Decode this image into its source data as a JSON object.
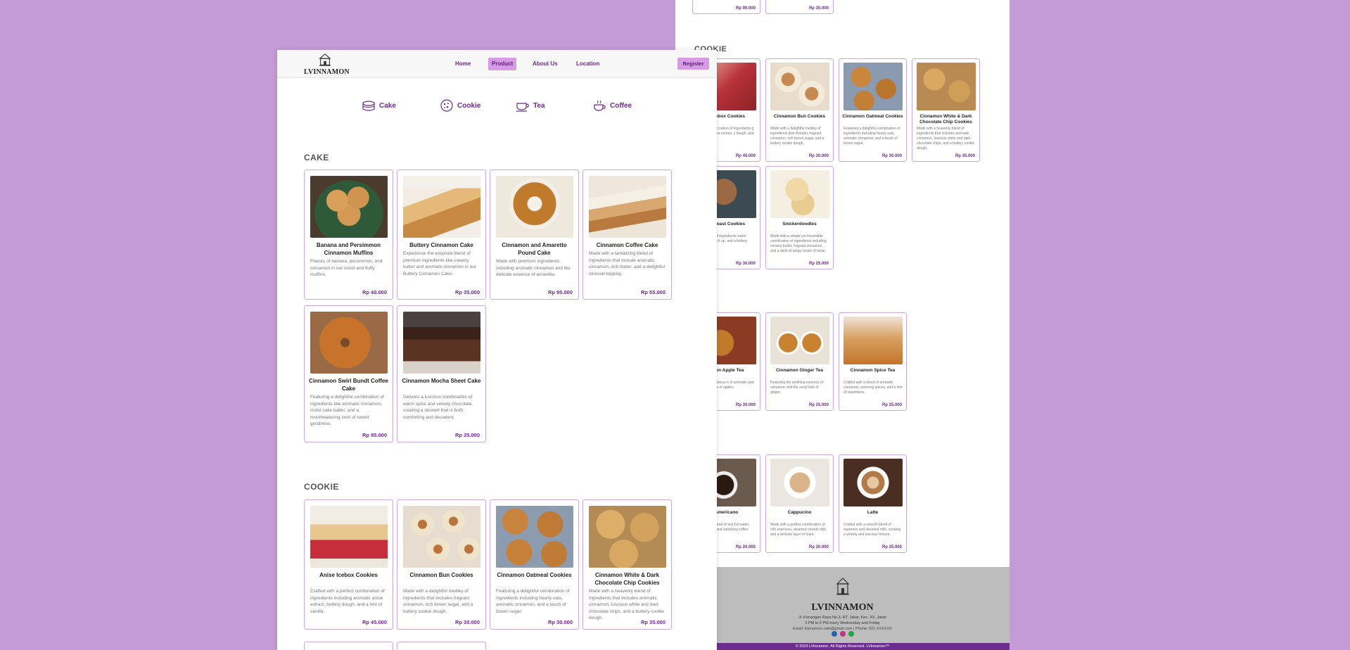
{
  "brand": {
    "name": "LVINNAMON"
  },
  "nav": {
    "links": [
      "Home",
      "Product",
      "About Us",
      "Location"
    ],
    "active": "Product",
    "register_label": "Register"
  },
  "categories": [
    "Cake",
    "Cookie",
    "Tea",
    "Coffee"
  ],
  "sections": {
    "cake": "CAKE",
    "cookie": "COOKIE"
  },
  "cakes": [
    {
      "name": "Banana and Persimmon Cinnamon Muffins",
      "desc": "Flavors of banana, persimmon, and cinnamon in our moist and fluffy muffins.",
      "price": "Rp 40.000"
    },
    {
      "name": "Buttery Cinnamon Cake",
      "desc": "Experience the exquisite blend of premium ingredients like creamy butter and aromatic cinnamon in our Buttery Cinnamon Cake.",
      "price": "Rp 35.000"
    },
    {
      "name": "Cinnamon and Amaretto Pound Cake",
      "desc": "Made with premium ingredients including aromatic cinnamon and the delicate essence of amaretto.",
      "price": "Rp 95.000"
    },
    {
      "name": "Cinnamon Coffee Cake",
      "desc": "Made with a tantalizing blend of ingredients that include aromatic cinnamon, rich butter, and a delightful streusel topping.",
      "price": "Rp 55.000"
    },
    {
      "name": "Cinnamon Swirl Bundt Coffee Cake",
      "desc": "Featuring a delightful combination of ingredients like aromatic cinnamon, moist cake batter, and a mouthwatering swirl of sweet goodness.",
      "price": "Rp 95.000"
    },
    {
      "name": "Cinnamon Mocha Sheet Cake",
      "desc": "Delivers a luscious combination of warm spice and velvety chocolate, creating a dessert that is both comforting and decadent.",
      "price": "Rp 35.000"
    }
  ],
  "cookies": [
    {
      "name": "Anise Icebox Cookies",
      "desc": "Crafted with a perfect combination of ingredients including aromatic anise extract, buttery dough, and a hint of vanilla.",
      "price": "Rp 45.000"
    },
    {
      "name": "Cinnamon Bun Cookies",
      "desc": "Made with a delightful medley of ingredients that includes fragrant cinnamon, rich brown sugar, and a buttery cookie dough.",
      "price": "Rp 30.000"
    },
    {
      "name": "Cinnamon Oatmeal Cookies",
      "desc": "Featuring a delightful combination of ingredients including hearty oats, aromatic cinnamon, and a touch of brown sugar.",
      "price": "Rp 30.000"
    },
    {
      "name": "Cinnamon White & Dark Chocolate Chip Cookies",
      "desc": "Made with a heavenly blend of ingredients that includes aromatic cinnamon, luscious white and dark chocolate chips, and a buttery cookie dough.",
      "price": "Rp 35.000"
    }
  ],
  "back": {
    "top_prices": [
      "Rp 90.000",
      "Rp 35.000"
    ],
    "cookie_title": "COOKIE",
    "cookies": [
      {
        "name": "e Icebox Cookies",
        "desc": "with a perfect nation of ingredients g aromatic anise extract, y dough, and a hint of",
        "price": "Rp 45.000"
      },
      {
        "name": "Cinnamon Bun Cookies",
        "desc": "Made with a delightful medley of ingredients that includes fragrant cinnamon, rich brown sugar, and a buttery cookie dough.",
        "price": "Rp 30.000"
      },
      {
        "name": "Cinnamon Oatmeal Cookies",
        "desc": "Featuring a delightful combination of ingredients including hearty oats, aromatic cinnamon, and a touch of brown sugar.",
        "price": "Rp 30.000"
      },
      {
        "name": "Cinnamon White & Dark Chocolate Chip Cookies",
        "desc": "Made with a heavenly blend of ingredients that includes aromatic cinnamon, luscious white and dark chocolate chips, and a buttery cookie dough.",
        "price": "Rp 35.000"
      },
      {
        "name": "ch Toast Cookies",
        "desc": "the medley of ingredients warm cinnamon, rich up, and a buttery",
        "price": "Rp 30.000"
      },
      {
        "name": "Snickerdoodles",
        "desc": "Made with a simple yet irresistible combination of ingredients including creamy butter, fragrant cinnamon, and a dash of tangy cream of tartar.",
        "price": "Rp 25.000"
      }
    ],
    "teas": [
      {
        "name": "amon Apple Tea",
        "desc": "with a harmonious n of aromatic and the natural ss of apples.",
        "price": "Rp 30.000"
      },
      {
        "name": "Cinnamon Ginger Tea",
        "desc": "Featuring the soothing essence of cinnamon and the zesty kick of ginger.",
        "price": "Rp 25.000"
      },
      {
        "name": "Cinnamon Spice Tea",
        "desc": "Crafted with a blend of aromatic cinnamon, warming spices, and a hint of sweetness.",
        "price": "Rp 25.000"
      }
    ],
    "coffee_title": "E",
    "coffees": [
      {
        "name": "Americano",
        "desc": "with a rich blend of and hot water, creating ust and satisfying coffee",
        "price": "Rp 20.000"
      },
      {
        "name": "Cappucino",
        "desc": "Made with a perfect combination of rich espresso, steamed velvety milk, and a delicate layer of foam.",
        "price": "Rp 30.000"
      },
      {
        "name": "Latte",
        "desc": "Crafted with a smooth blend of espresso and steamed milk, creating a velvety and luscious texture.",
        "price": "Rp 25.000"
      }
    ],
    "footer": {
      "brand": "LVINNAMON",
      "address": "Jl. Kenangan Raya No.3, RT. Jakar, Kec. XX, Jakar",
      "hours": "3 PM to 5 PM every Wednesday and Friday",
      "contact": "Email: lvinnamon.cafe@gmail.com | Phone: 021-XXXXXX",
      "copyright": "© 2023 LVinnamon. All Rights Reserved. LVinnamon™"
    }
  },
  "colors": {
    "accent": "#6a2b8a",
    "accent_light": "#d79be6",
    "background": "#c49bd6",
    "card_border": "#c6a9de",
    "footer_bg": "#bdbdbd"
  }
}
